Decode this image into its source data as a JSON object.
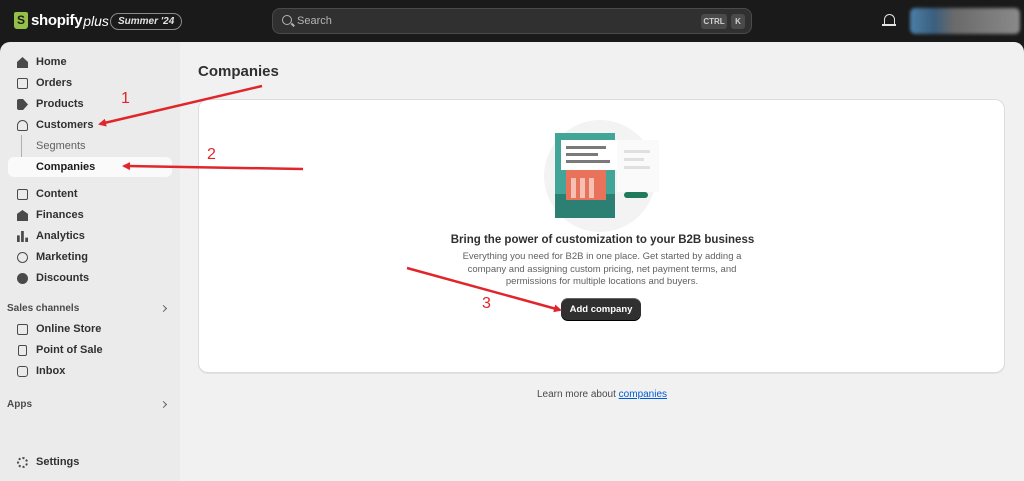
{
  "topbar": {
    "logo_text": "shopify",
    "logo_plus": "plus",
    "edition_badge": "Summer '24",
    "search_placeholder": "Search",
    "shortcut_ctrl": "CTRL",
    "shortcut_key": "K"
  },
  "sidebar": {
    "items": [
      {
        "label": "Home",
        "icon": "home-icon"
      },
      {
        "label": "Orders",
        "icon": "orders-icon"
      },
      {
        "label": "Products",
        "icon": "tag-icon"
      },
      {
        "label": "Customers",
        "icon": "person-icon"
      },
      {
        "label": "Segments",
        "icon": ""
      },
      {
        "label": "Companies",
        "icon": ""
      },
      {
        "label": "Content",
        "icon": "content-icon"
      },
      {
        "label": "Finances",
        "icon": "bank-icon"
      },
      {
        "label": "Analytics",
        "icon": "bar-chart-icon"
      },
      {
        "label": "Marketing",
        "icon": "target-icon"
      },
      {
        "label": "Discounts",
        "icon": "discount-icon"
      }
    ],
    "sales_channels_label": "Sales channels",
    "sales_channels": [
      {
        "label": "Online Store",
        "icon": "store-icon"
      },
      {
        "label": "Point of Sale",
        "icon": "pos-icon"
      },
      {
        "label": "Inbox",
        "icon": "inbox-icon"
      }
    ],
    "apps_label": "Apps",
    "settings_label": "Settings"
  },
  "main": {
    "page_title": "Companies",
    "empty_state": {
      "heading": "Bring the power of customization to your B2B business",
      "body": "Everything you need for B2B in one place. Get started by adding a company and assigning custom pricing, net payment terms, and permissions for multiple locations and buyers.",
      "button_label": "Add company"
    },
    "learn_more_prefix": "Learn more about ",
    "learn_more_link": "companies"
  },
  "annotations": {
    "step1": "1",
    "step2": "2",
    "step3": "3",
    "color": "#e0262a"
  }
}
